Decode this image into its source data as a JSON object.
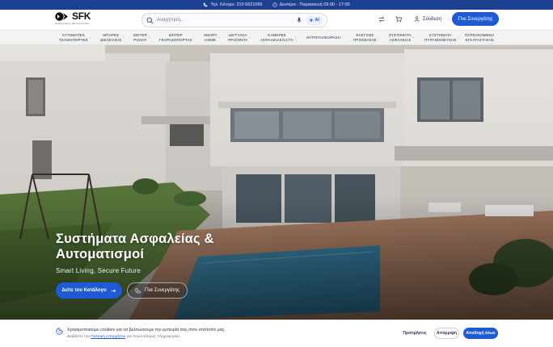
{
  "topbar": {
    "phone": "Τηλ. Κέντρο: 210 6621065",
    "hours": "Δευτέρα - Παρασκευή 09:00 - 17:00"
  },
  "header": {
    "logo_text": "SFK",
    "logo_tagline": "Smart Living, Secure Future",
    "search_placeholder": "Αναζήτηση...",
    "ai_label": "AI",
    "login_label": "Σύνδεση",
    "partner_label": "Γίνε Συνεργάτης"
  },
  "nav": {
    "items": [
      {
        "l1": "ΑΥΤΟΜΑΤΕΣ",
        "l2": "ΤΖΑΜΟΠΟΡΤΕΣ"
      },
      {
        "l1": "ΜΠΑΡΕΣ",
        "l2": "ΔΙΕΛΕΥΣΗΣ"
      },
      {
        "l1": "ΜΟΤΕΡ",
        "l2": "ΡΟΛΟΥ"
      },
      {
        "l1": "ΜΟΤΕΡ",
        "l2": "ΓΚΑΡΑΖΟΠΟΡΤΑΣ"
      },
      {
        "l1": "SMART",
        "l2": "HOME"
      },
      {
        "l1": "ΔΙΚΤΥΑΚΑ",
        "l2": "ΠΡΟΪΟΝΤΑ"
      },
      {
        "l1": "ΚΑΜΕΡΕΣ",
        "l2": "ΑΣΦΑΛΕΙΑΣ/CCTV"
      },
      {
        "l1": "ΘΥΡΟΤΗΛΕΟΡΑΣΗ",
        "l2": ""
      },
      {
        "l1": "ΕΛΕΓΧΟΣ",
        "l2": "ΠΡΟΣΒΑΣΗΣ"
      },
      {
        "l1": "ΣΥΣΤΗΜΑΤΑ",
        "l2": "ΑΣΦΑΛΕΙΑΣ"
      },
      {
        "l1": "ΣΥΣΤΗΜΑΤΑ",
        "l2": "ΠΥΡΑΝΙΧΝΕΥΣΗΣ"
      },
      {
        "l1": "ΠΑΡΕΛΚΟΜΕΝΑ",
        "l2": "ΕΓΚΑΤΑΣΤΑΣΗΣ"
      }
    ]
  },
  "hero": {
    "title": "Συστήματα Ασφαλείας & Αυτοματισμοί",
    "subtitle": "Smart Living, Secure Future",
    "cta_primary": "Δείτε τον Κατάλογο",
    "cta_secondary": "Γίνε Συνεργάτης"
  },
  "cookie": {
    "text": "Χρησιμοποιούμε cookies για να βελτιώσουμε την εμπειρία σας στον ιστότοπό μας.",
    "sub_before": "Διαβάστε την",
    "sub_link": "Πολιτική Απορρήτου",
    "sub_after": "για περισσότερες πληροφορίες.",
    "pref_label": "Προτιμήσεις",
    "reject_label": "Απόρριψη",
    "accept_label": "Αποδοχή όλων"
  },
  "colors": {
    "brand_blue": "#1f5ad6",
    "topbar_blue": "#1d3f8f",
    "nav_bg": "#f3f3f1"
  }
}
